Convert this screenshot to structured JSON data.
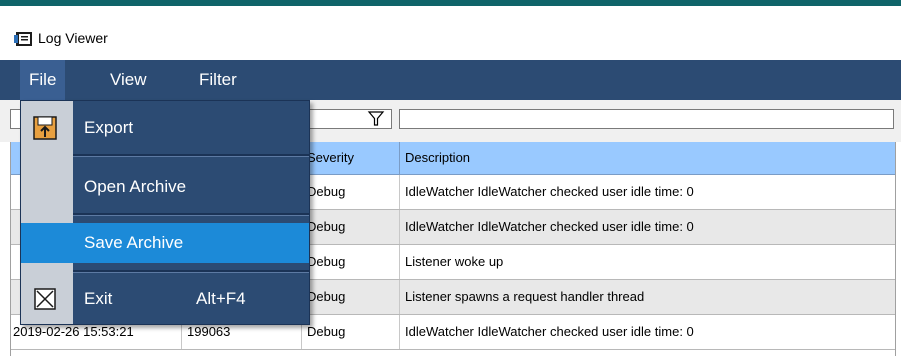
{
  "window": {
    "title": "Log Viewer",
    "app_icon": "log-viewer-icon"
  },
  "menubar": {
    "items": [
      "File",
      "View",
      "Filter"
    ]
  },
  "file_menu": {
    "items": [
      {
        "label": "Export",
        "icon": "floppy-export-icon"
      },
      {
        "label": "Open Archive"
      },
      {
        "label": "Save Archive",
        "highlighted": true
      },
      {
        "label": "Exit",
        "shortcut": "Alt+F4",
        "icon": "close-box-icon"
      }
    ]
  },
  "table": {
    "columns": [
      "Severity",
      "Description"
    ],
    "rows": [
      {
        "time": "",
        "id": "",
        "severity": "Debug",
        "description": "IdleWatcher IdleWatcher checked user idle time: 0"
      },
      {
        "time": "",
        "id": "",
        "severity": "Debug",
        "description": "IdleWatcher IdleWatcher checked user idle time: 0"
      },
      {
        "time": "",
        "id": "",
        "severity": "Debug",
        "description": "Listener woke up"
      },
      {
        "time": "",
        "id": "",
        "severity": "Debug",
        "description": "Listener spawns a request handler thread"
      },
      {
        "time": "2019-02-26 15:53:21",
        "id": "199063",
        "severity": "Debug",
        "description": "IdleWatcher IdleWatcher checked user idle time: 0"
      }
    ]
  },
  "colors": {
    "menubar": "#2c4b73",
    "menu_highlight": "#1c8ad8",
    "header": "#99c9ff",
    "accent_stripe": "#0f6469"
  }
}
